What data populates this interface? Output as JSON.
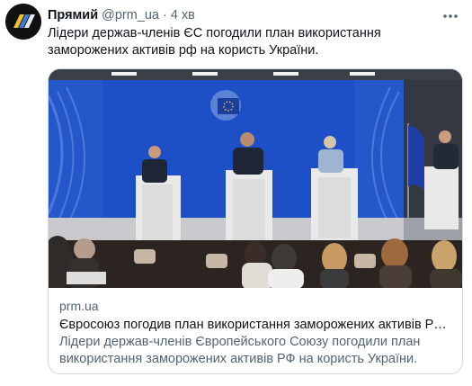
{
  "tweet": {
    "author_name": "Прямий",
    "author_handle": "@prm_ua",
    "separator": "·",
    "time": "4 хв",
    "text": "Лідери держав-членів ЄС погодили план використання заморожених активів рф на користь України.",
    "avatar_icon": "pryamiy-logo-icon",
    "more_icon": "more-dots-icon"
  },
  "card": {
    "domain": "prm.ua",
    "title": "Євросоюз погодив план використання заморожених активів РФ на...",
    "description": "Лідери держав-членів Європейського Союзу погодили план використання заморожених активів РФ на користь України. Більш ..."
  },
  "colors": {
    "stage_blue": "#1d4fc6",
    "text_primary": "#0f1419",
    "text_secondary": "#536471",
    "border": "#cfd9de"
  }
}
